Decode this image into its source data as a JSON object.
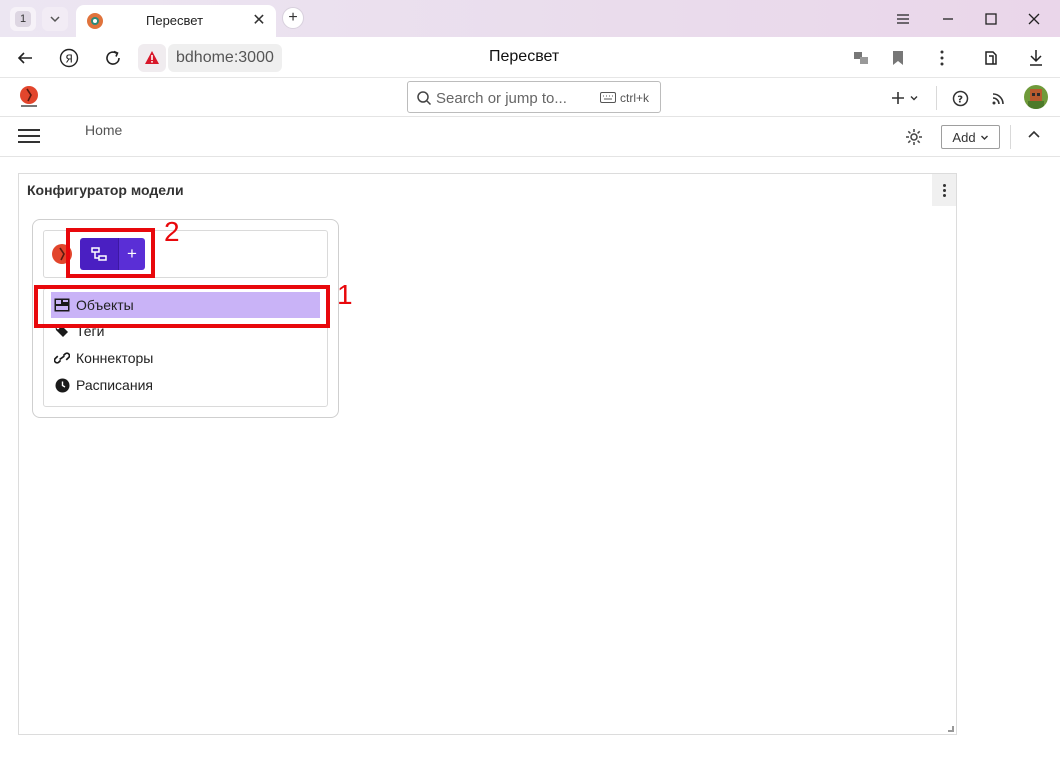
{
  "browser": {
    "tab_count": "1",
    "tab_title": "Пересвет",
    "address_host": "bdhome:3000",
    "address_title": "Пересвет"
  },
  "app": {
    "search_placeholder": "Search or jump to...",
    "search_shortcut": "ctrl+k",
    "breadcrumb": "Home",
    "add_label": "Add"
  },
  "panel": {
    "title": "Конфигуратор модели",
    "menu": [
      {
        "label": "Объекты",
        "icon": "objects-icon",
        "active": true
      },
      {
        "label": "Теги",
        "icon": "tags-icon"
      },
      {
        "label": "Коннекторы",
        "icon": "link-icon"
      },
      {
        "label": "Расписания",
        "icon": "clock-icon"
      }
    ]
  },
  "annotations": {
    "one": "1",
    "two": "2",
    "color": "#e8080c"
  },
  "colors": {
    "accent": "#4a1fc2",
    "selected": "#c9b3f7"
  }
}
